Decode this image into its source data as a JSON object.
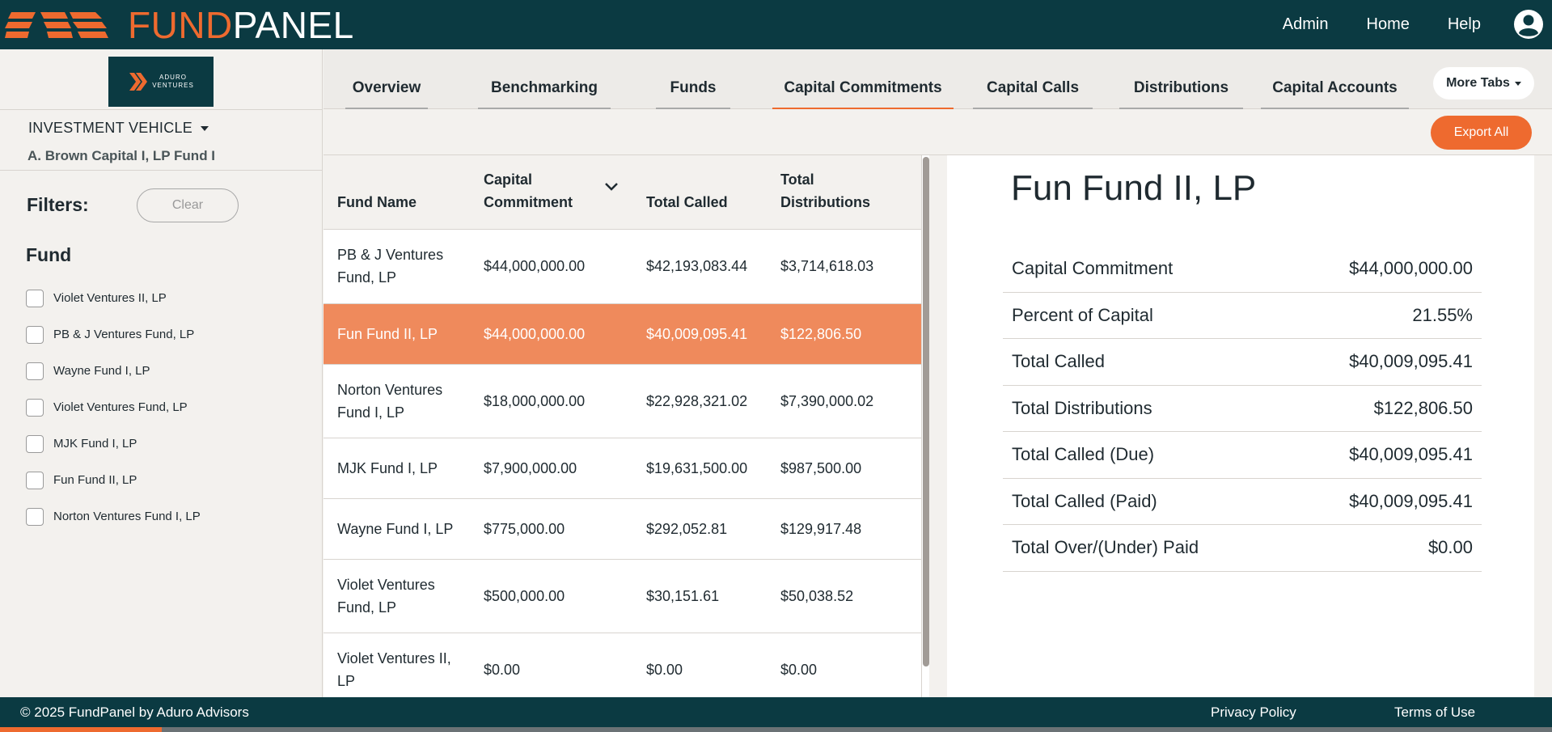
{
  "app": {
    "logo_fund": "FUND",
    "logo_panel": "PANEL",
    "nav": [
      "Admin",
      "Home",
      "Help"
    ]
  },
  "brand": {
    "line1": "ADURO",
    "line2": "VENTURES"
  },
  "sidebar": {
    "investment_vehicle_label": "INVESTMENT VEHICLE",
    "investment_vehicle_value": "A. Brown Capital I, LP Fund I",
    "filters_label": "Filters:",
    "clear_label": "Clear",
    "fund_heading": "Fund",
    "funds": [
      "Violet Ventures II, LP",
      "PB & J Ventures Fund, LP",
      "Wayne Fund I, LP",
      "Violet Ventures Fund, LP",
      "MJK Fund I, LP",
      "Fun Fund II, LP",
      "Norton Ventures Fund I, LP"
    ]
  },
  "tabs": {
    "items": [
      "Overview",
      "Benchmarking",
      "Funds",
      "Capital Commitments",
      "Capital Calls",
      "Distributions",
      "Capital Accounts"
    ],
    "active": "Capital Commitments",
    "more_label": "More Tabs"
  },
  "actions": {
    "export_label": "Export All"
  },
  "table": {
    "headers": {
      "fund_name": "Fund Name",
      "capital_commitment_1": "Capital",
      "capital_commitment_2": "Commitment",
      "total_called": "Total Called",
      "total_distributions_1": "Total",
      "total_distributions_2": "Distributions"
    },
    "rows": [
      {
        "name1": "PB & J Ventures",
        "name2": "Fund, LP",
        "commitment": "$44,000,000.00",
        "called": "$42,193,083.44",
        "distributions": "$3,714,618.03"
      },
      {
        "name1": "Fun Fund II, LP",
        "name2": "",
        "commitment": "$44,000,000.00",
        "called": "$40,009,095.41",
        "distributions": "$122,806.50"
      },
      {
        "name1": "Norton Ventures",
        "name2": "Fund I, LP",
        "commitment": "$18,000,000.00",
        "called": "$22,928,321.02",
        "distributions": "$7,390,000.02"
      },
      {
        "name1": "MJK Fund I, LP",
        "name2": "",
        "commitment": "$7,900,000.00",
        "called": "$19,631,500.00",
        "distributions": "$987,500.00"
      },
      {
        "name1": "Wayne Fund I, LP",
        "name2": "",
        "commitment": "$775,000.00",
        "called": "$292,052.81",
        "distributions": "$129,917.48"
      },
      {
        "name1": "Violet Ventures",
        "name2": "Fund, LP",
        "commitment": "$500,000.00",
        "called": "$30,151.61",
        "distributions": "$50,038.52"
      },
      {
        "name1": "Violet Ventures II,",
        "name2": "LP",
        "commitment": "$0.00",
        "called": "$0.00",
        "distributions": "$0.00"
      }
    ]
  },
  "detail": {
    "title": "Fun Fund II, LP",
    "items": [
      {
        "label": "Capital Commitment",
        "value": "$44,000,000.00"
      },
      {
        "label": "Percent of Capital",
        "value": "21.55%"
      },
      {
        "label": "Total Called",
        "value": "$40,009,095.41"
      },
      {
        "label": "Total Distributions",
        "value": "$122,806.50"
      },
      {
        "label": "Total Called (Due)",
        "value": "$40,009,095.41"
      },
      {
        "label": "Total Called (Paid)",
        "value": "$40,009,095.41"
      },
      {
        "label": "Total Over/(Under) Paid",
        "value": "$0.00"
      }
    ]
  },
  "footer": {
    "copyright": "© 2025 FundPanel by Aduro Advisors",
    "privacy": "Privacy Policy",
    "terms": "Terms of Use"
  },
  "colors": {
    "primary": "#0b3a42",
    "accent": "#ee6a2f",
    "selected_row": "#ef8a5c"
  },
  "page_progress": 0.104
}
